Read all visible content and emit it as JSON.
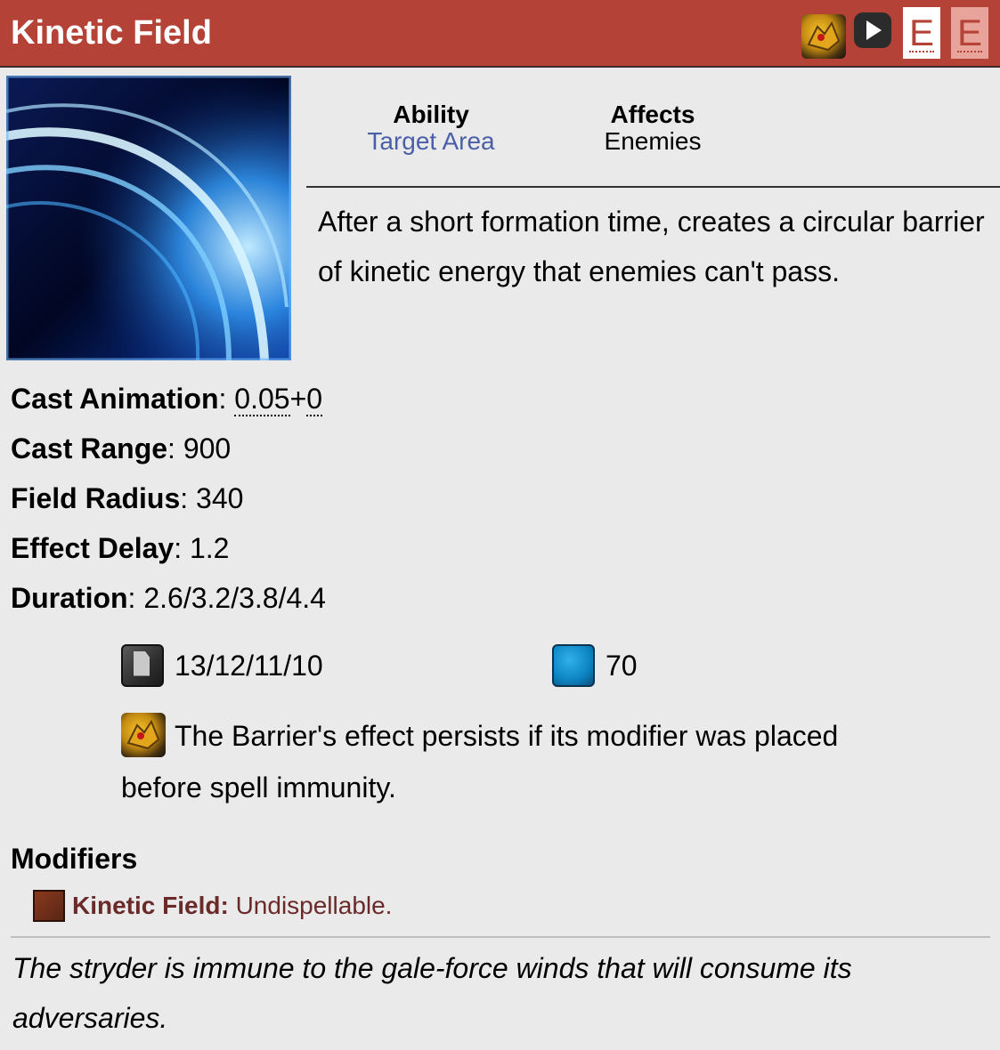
{
  "header": {
    "title": "Kinetic Field",
    "hero_icon": "disruptor-hero-icon",
    "play_icon": "play-icon",
    "hotkeys": [
      "E",
      "E"
    ],
    "accent_color": "#b54237"
  },
  "ability": {
    "image": "kinetic-field-ability-image",
    "type_label": "Ability",
    "type_value": "Target Area",
    "affects_label": "Affects",
    "affects_value": "Enemies",
    "description": "After a short formation time, creates a circular barrier of kinetic energy that enemies can't pass."
  },
  "stats": [
    {
      "label": "Cast Animation",
      "sep": ": ",
      "value_a": "0.05",
      "plus": "+",
      "value_b": "0"
    },
    {
      "label": "Cast Range",
      "sep": ": ",
      "value": "900"
    },
    {
      "label": "Field Radius",
      "sep": ": ",
      "value": "340"
    },
    {
      "label": "Effect Delay",
      "sep": ": ",
      "value": "1.2"
    },
    {
      "label": "Duration",
      "sep": ": ",
      "value": "2.6/3.2/3.8/4.4"
    }
  ],
  "costs": {
    "cooldown_icon": "cooldown-icon",
    "cooldown": "13/12/11/10",
    "mana_icon": "mana-icon",
    "mana": "70"
  },
  "note": {
    "icon": "disruptor-hero-icon",
    "text": "The Barrier's effect persists if its modifier was placed before spell immunity."
  },
  "modifiers": {
    "heading": "Modifiers",
    "items": [
      {
        "icon": "modifier-icon",
        "name": "Kinetic Field:",
        "text": " Undispellable."
      }
    ]
  },
  "lore": "The stryder is immune to the gale-force winds that will consume its adversaries."
}
